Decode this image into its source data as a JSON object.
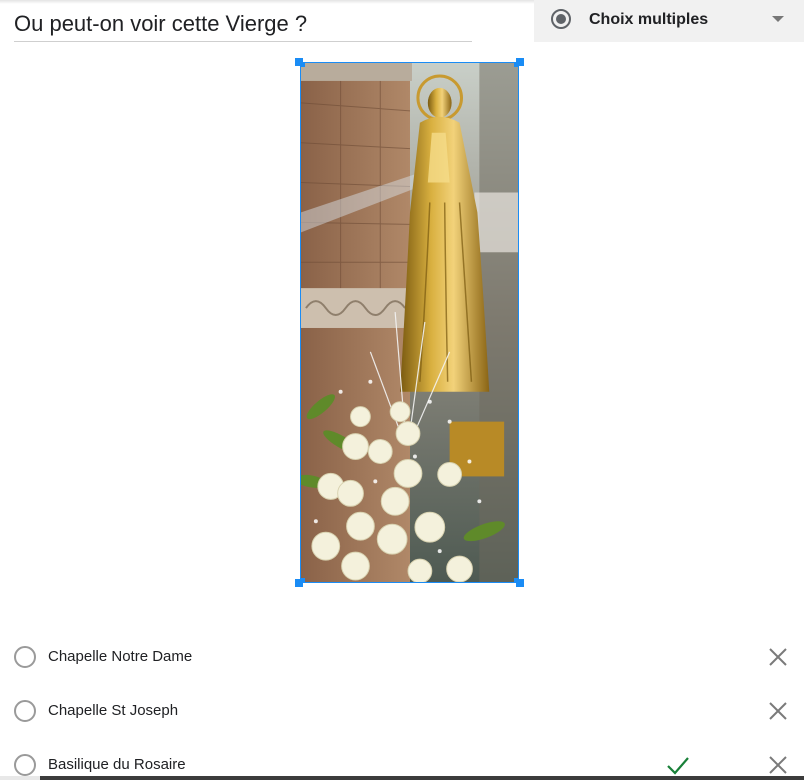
{
  "question": {
    "title": "Ou peut-on voir cette Vierge ?"
  },
  "question_type": {
    "label": "Choix multiples",
    "icon": "radio-button-checked-icon"
  },
  "image": {
    "subject": "golden-virgin-statue-with-white-roses-photo"
  },
  "options": [
    {
      "label": "Chapelle Notre Dame",
      "correct": false
    },
    {
      "label": "Chapelle St Joseph",
      "correct": false
    },
    {
      "label": "Basilique du Rosaire",
      "correct": true
    }
  ],
  "colors": {
    "selection_blue": "#1a8cf5",
    "correct_green": "#188038",
    "icon_gray": "#5f6368"
  }
}
